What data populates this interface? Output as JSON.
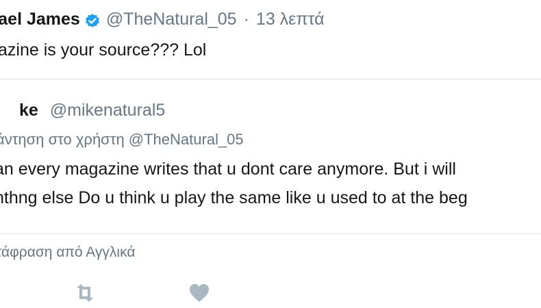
{
  "tweet": {
    "display_name": "hael James",
    "handle": "@TheNatural_05",
    "separator": "·",
    "time": "13 λεπτά",
    "text": "azine is your source??? Lol",
    "verified_icon": "verified-badge-icon",
    "verified_color": "#1da1f2"
  },
  "quoted": {
    "display_name": "ke",
    "handle": "@mikenatural5",
    "reply_to": "άντηση στο χρήστη @TheNatural_05",
    "lines": [
      "an every magazine writes that u dont care anymore. But i will",
      "nthng else Do u think u play the same like u used to at the beg"
    ]
  },
  "translate_label": "τάφραση από Αγγλικά",
  "actions": {
    "retweet_icon": "retweet-icon",
    "like_icon": "heart-icon",
    "icon_color": "#aab8c2"
  }
}
